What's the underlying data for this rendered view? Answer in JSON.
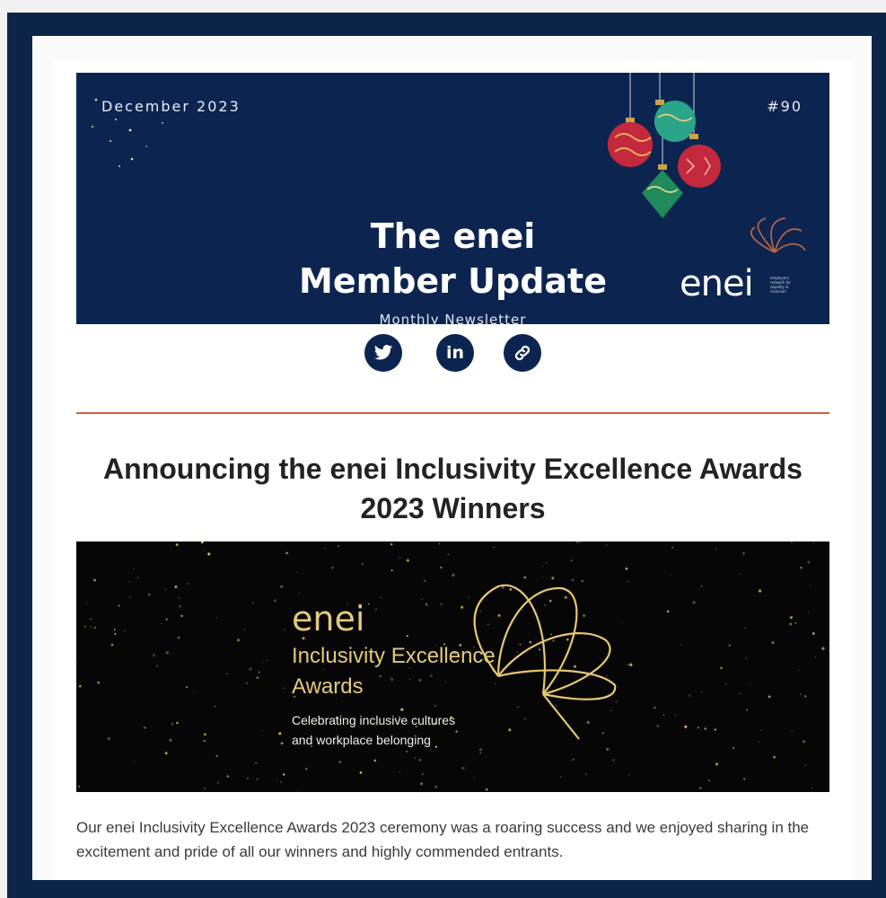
{
  "header": {
    "date": "December 2023",
    "issue": "#90",
    "title_line1": "The enei",
    "title_line2": "Member Update",
    "subtitle": "Monthly Newsletter",
    "logo_word": "enei",
    "logo_small": "employers network for equality & inclusion"
  },
  "social": {
    "twitter_icon": "twitter-icon",
    "linkedin_label": "in",
    "link_icon": "link-icon"
  },
  "article": {
    "headline": "Announcing the enei Inclusivity Excellence Awards 2023 Winners",
    "awards_banner": {
      "logo_word": "enei",
      "line1": "Inclusivity Excellence",
      "line2": "Awards",
      "tagline1": "Celebrating inclusive cultures",
      "tagline2": "and workplace belonging"
    },
    "body": "Our enei Inclusivity Excellence Awards 2023 ceremony was a roaring success and we enjoyed sharing in the excitement and pride of all our winners and highly commended entrants."
  },
  "colors": {
    "navy": "#0c2550",
    "accent": "#c8643a",
    "gold": "#e3c97a"
  }
}
